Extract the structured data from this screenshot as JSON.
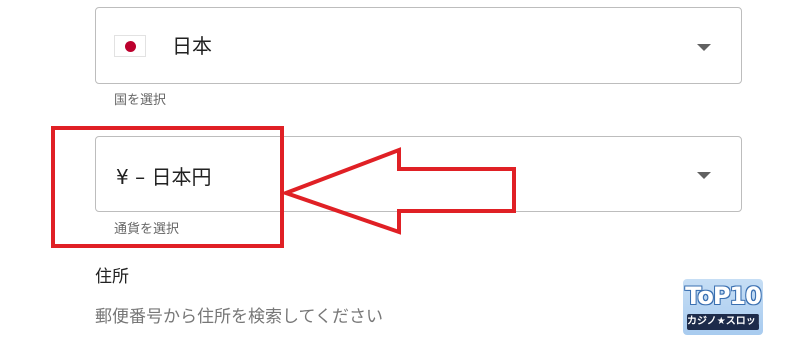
{
  "country_select": {
    "value": "日本",
    "helper": "国を選択"
  },
  "currency_select": {
    "value": "¥ – 日本円",
    "helper": "通貨を選択"
  },
  "address": {
    "label": "住所",
    "search_placeholder": "郵便番号から住所を検索してください"
  },
  "logo": {
    "main": "ToP10",
    "sub": "カジノ★スロット"
  },
  "colors": {
    "annotation": "#e02025",
    "flag_red": "#bc002d",
    "border": "#bdbdbd"
  },
  "icons": {
    "flag": "japan-flag-icon",
    "caret": "chevron-down-icon",
    "arrow": "left-arrow-annotation"
  }
}
